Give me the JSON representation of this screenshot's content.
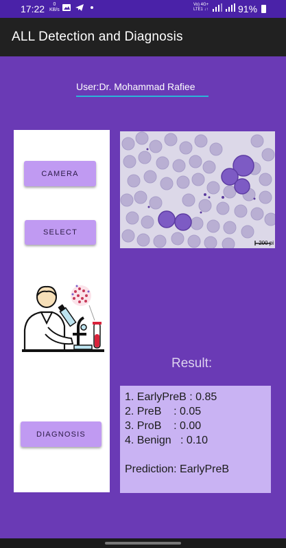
{
  "status_bar": {
    "time": "17:22",
    "net_speed_value": "0",
    "net_speed_unit": "KB/s",
    "network_type_top": "Vo) 4G+",
    "network_type_bottom": "LTE1 ↓↑",
    "battery_percent": "91%"
  },
  "app_bar": {
    "title": "ALL Detection and Diagnosis"
  },
  "user": {
    "label": "User:Dr. Mohammad Rafiee"
  },
  "buttons": {
    "camera": "CAMERA",
    "select": "SELECT",
    "diagnosis": "DIAGNOSIS"
  },
  "image": {
    "scale_label": "200 pi"
  },
  "result": {
    "label": "Result:",
    "lines": [
      "1. EarlyPreB : 0.85",
      "2. PreB    : 0.05",
      "3. ProB    : 0.00",
      "4. Benign   : 0.10"
    ],
    "prediction": "Prediction: EarlyPreB"
  },
  "colors": {
    "background": "#6a3ab5",
    "status_bar": "#4a22a8",
    "app_bar": "#212121",
    "button": "#c09af2",
    "result_box": "#c9b3f3",
    "underline": "#29b6d9"
  },
  "icons": [
    "gallery-icon",
    "telegram-icon",
    "dot-icon",
    "signal-icon",
    "battery-icon",
    "scientist-microscope-illustration"
  ]
}
